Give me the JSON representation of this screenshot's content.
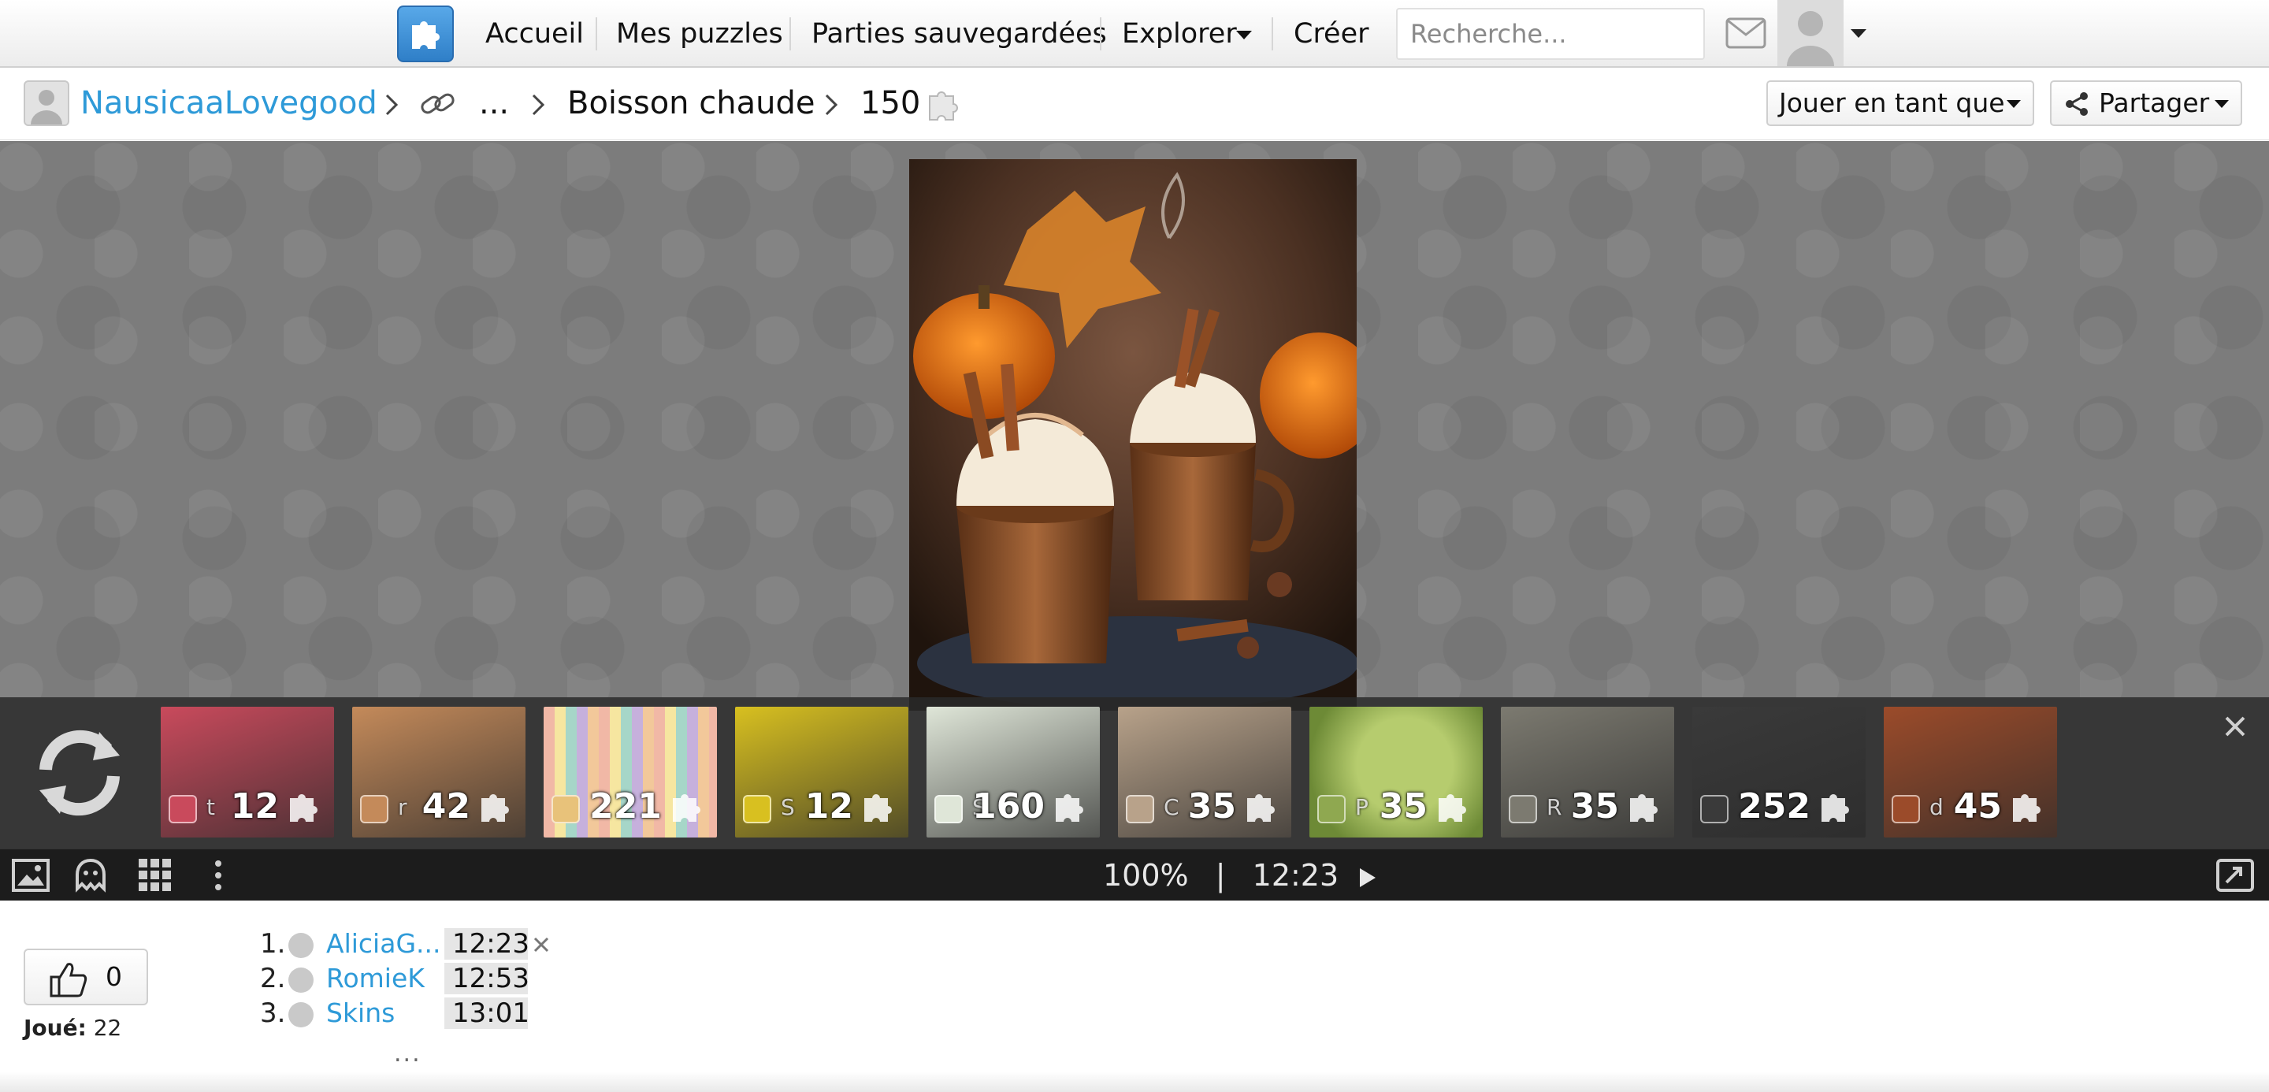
{
  "nav": {
    "items": [
      "Accueil",
      "Mes puzzles",
      "Parties sauvegardées",
      "Explorer",
      "Créer"
    ],
    "search_placeholder": "Recherche..."
  },
  "breadcrumb": {
    "user": "NausicaaLovegood",
    "ellipsis": "...",
    "category": "Boisson chaude",
    "pieces": "150"
  },
  "actions": {
    "play_as": "Jouer en tant que",
    "share": "Partager"
  },
  "thumbnails": [
    {
      "count": "12",
      "label": "t",
      "theme": "tulips",
      "color": "#c94a5c"
    },
    {
      "count": "42",
      "label": "r",
      "theme": "portrait",
      "color": "#c48a5a"
    },
    {
      "count": "221",
      "label": "",
      "theme": "stripes",
      "color": "#e8c27a"
    },
    {
      "count": "12",
      "label": "S",
      "theme": "crocus",
      "color": "#d8c020"
    },
    {
      "count": "160",
      "label": "S",
      "theme": "table",
      "color": "#dfe6d8"
    },
    {
      "count": "35",
      "label": "C",
      "theme": "vases",
      "color": "#b8a28a"
    },
    {
      "count": "35",
      "label": "P",
      "theme": "green-fruit",
      "color": "#8fa850"
    },
    {
      "count": "35",
      "label": "R",
      "theme": "building",
      "color": "#7c7a70"
    },
    {
      "count": "252",
      "label": "",
      "theme": "stage",
      "color": "#3a3a3a"
    },
    {
      "count": "45",
      "label": "d",
      "theme": "grill",
      "color": "#9b4b2a"
    }
  ],
  "status": {
    "zoom": "100%",
    "separator": "|",
    "time": "12:23"
  },
  "likes": {
    "count": "0"
  },
  "played": {
    "label": "Joué:",
    "value": "22"
  },
  "leaderboard": [
    {
      "rank": "1.",
      "name": "AliciaG...",
      "time": "12:23"
    },
    {
      "rank": "2.",
      "name": "RomieK",
      "time": "12:53"
    },
    {
      "rank": "3.",
      "name": "Skins",
      "time": "13:01"
    }
  ],
  "leaderboard_more": "..."
}
